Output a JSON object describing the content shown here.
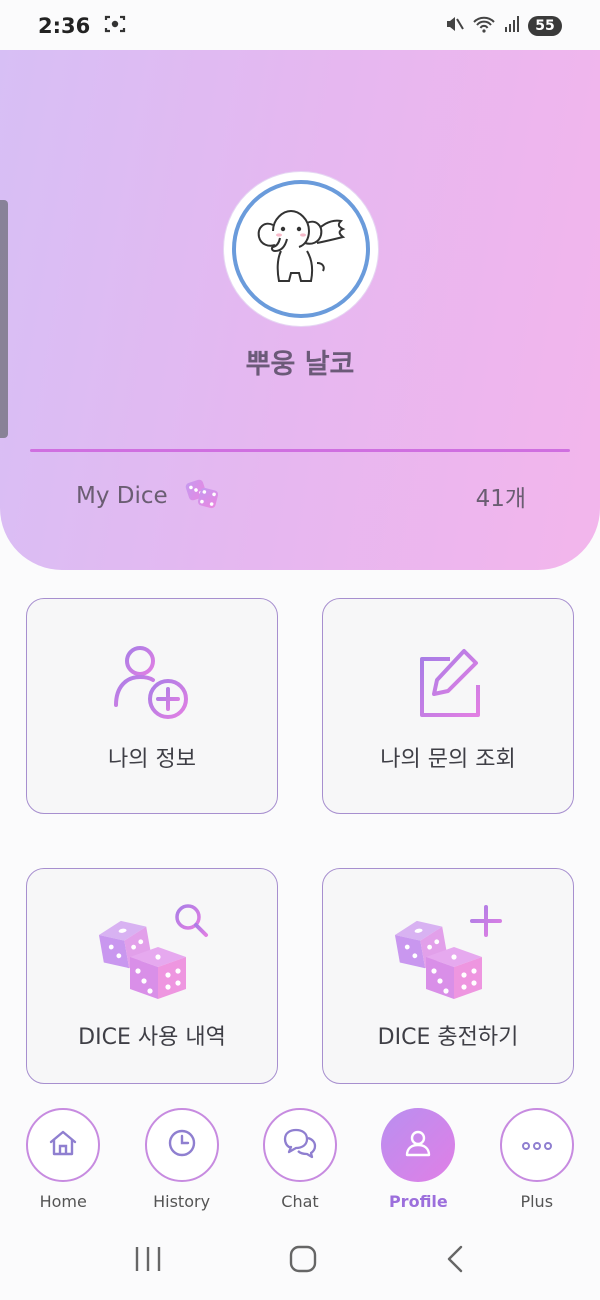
{
  "status_bar": {
    "time": "2:36",
    "battery": "55",
    "icons": [
      "screenshot-icon",
      "mute-icon",
      "wifi-icon",
      "signal-icon",
      "battery-icon"
    ]
  },
  "profile": {
    "name": "뿌웅 날코",
    "avatar": "elephant-avatar"
  },
  "dice": {
    "label": "My Dice",
    "count": "41개",
    "icon": "dice-icon"
  },
  "menu": [
    {
      "label": "나의 정보",
      "icon": "user-add-icon"
    },
    {
      "label": "나의 문의 조회",
      "icon": "edit-icon"
    },
    {
      "label": "DICE 사용 내역",
      "icon": "dice-search-icon"
    },
    {
      "label": "DICE 충전하기",
      "icon": "dice-plus-icon"
    }
  ],
  "nav": [
    {
      "label": "Home",
      "icon": "home-icon",
      "active": false
    },
    {
      "label": "History",
      "icon": "clock-icon",
      "active": false
    },
    {
      "label": "Chat",
      "icon": "chat-icon",
      "active": false
    },
    {
      "label": "Profile",
      "icon": "profile-icon",
      "active": true
    },
    {
      "label": "Plus",
      "icon": "more-icon",
      "active": false
    }
  ],
  "colors": {
    "header_gradient_start": "#d7bff5",
    "header_gradient_end": "#f3b6ec",
    "accent_purple": "#a97de6",
    "accent_pink": "#e07fe6",
    "card_border": "#a78fcf",
    "active_label": "#9c6fdc"
  }
}
